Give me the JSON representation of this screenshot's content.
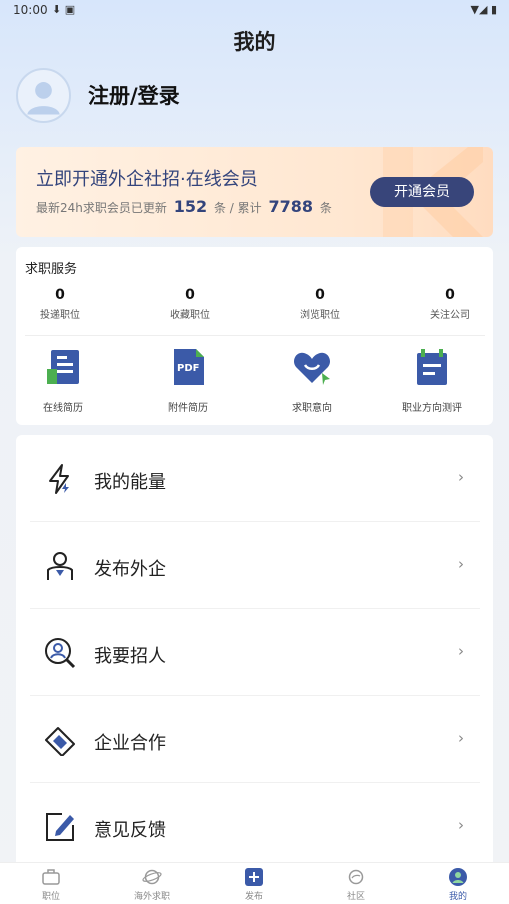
{
  "status": {
    "time": "10:00",
    "left_icons": "⬇ ▣",
    "right_icons": "▼◢ ▮"
  },
  "header": {
    "title": "我的"
  },
  "profile": {
    "login_text": "注册/登录"
  },
  "vip": {
    "title": "立即开通外企社招·在线会员",
    "sub_prefix": "最新24h求职会员已更新",
    "updated_count": "152",
    "sub_mid": "条 / 累计",
    "total_count": "7788",
    "sub_suffix": "条",
    "button_label": "开通会员"
  },
  "services": {
    "title": "求职服务",
    "stats": [
      {
        "value": "0",
        "label": "投递职位"
      },
      {
        "value": "0",
        "label": "收藏职位"
      },
      {
        "value": "0",
        "label": "浏览职位"
      },
      {
        "value": "0",
        "label": "关注公司"
      }
    ],
    "tools": [
      {
        "label": "在线简历",
        "icon": "online-resume-icon"
      },
      {
        "label": "附件简历",
        "icon": "pdf-resume-icon"
      },
      {
        "label": "求职意向",
        "icon": "heart-intent-icon"
      },
      {
        "label": "职业方向测评",
        "icon": "career-assessment-icon"
      }
    ]
  },
  "menu": [
    {
      "label": "我的能量",
      "icon": "lightning-icon"
    },
    {
      "label": "发布外企",
      "icon": "publish-company-icon"
    },
    {
      "label": "我要招人",
      "icon": "recruit-search-icon"
    },
    {
      "label": "企业合作",
      "icon": "handshake-icon"
    },
    {
      "label": "意见反馈",
      "icon": "feedback-edit-icon"
    }
  ],
  "menu_chevron": "›",
  "tabbar": [
    {
      "label": "职位",
      "icon": "briefcase-icon",
      "active": false
    },
    {
      "label": "海外求职",
      "icon": "planet-icon",
      "active": false
    },
    {
      "label": "发布",
      "icon": "plus-icon",
      "active": false
    },
    {
      "label": "社区",
      "icon": "community-icon",
      "active": false
    },
    {
      "label": "我的",
      "icon": "profile-icon",
      "active": true
    }
  ],
  "colors": {
    "accent": "#3b5aa8",
    "vip_dark": "#38457a"
  }
}
